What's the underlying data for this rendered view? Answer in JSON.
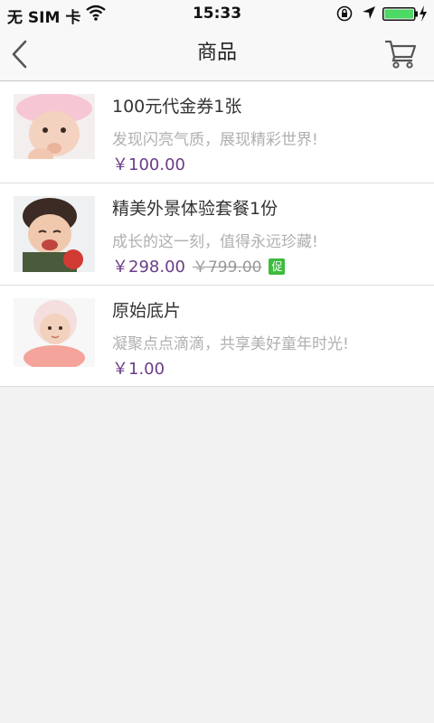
{
  "status_bar": {
    "carrier": "无 SIM 卡",
    "time": "15:33",
    "icons": [
      "wifi-icon",
      "rotation-lock-icon",
      "location-arrow-icon",
      "battery-icon",
      "charging-bolt-icon"
    ],
    "battery_level": 1.0
  },
  "nav": {
    "title": "商品",
    "back_icon": "chevron-left-icon",
    "cart_icon": "shopping-cart-icon"
  },
  "colors": {
    "price": "#6b3d86",
    "promo_badge": "#3dbb3d",
    "battery_fill": "#4cd964"
  },
  "products": [
    {
      "name": "100元代金券1张",
      "description": "发现闪亮气质，展现精彩世界!",
      "price": "￥100.00",
      "original_price": "",
      "promo": ""
    },
    {
      "name": "精美外景体验套餐1份",
      "description": "成长的这一刻，值得永远珍藏!",
      "price": "￥298.00",
      "original_price": "￥799.00",
      "promo": "促"
    },
    {
      "name": "原始底片",
      "description": "凝聚点点滴滴，共享美好童年时光!",
      "price": "￥1.00",
      "original_price": "",
      "promo": ""
    }
  ]
}
